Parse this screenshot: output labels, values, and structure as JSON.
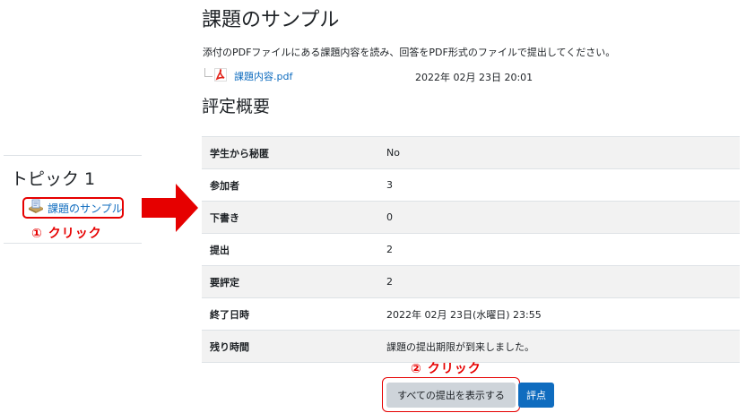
{
  "sidebar": {
    "topic_title": "トピック 1",
    "activity_link": "課題のサンプル",
    "step1_note": "① クリック"
  },
  "main": {
    "title": "課題のサンプル",
    "intro": "添付のPDFファイルにある課題内容を読み、回答をPDF形式のファイルで提出してください。",
    "attachment": {
      "name": "課題内容.pdf",
      "date": "2022年 02月 23日 20:01",
      "icon": "pdf-icon"
    },
    "summary_heading": "評定概要",
    "summary_rows": [
      {
        "key": "学生から秘匿",
        "value": "No"
      },
      {
        "key": "参加者",
        "value": "3"
      },
      {
        "key": "下書き",
        "value": "0"
      },
      {
        "key": "提出",
        "value": "2"
      },
      {
        "key": "要評定",
        "value": "2"
      },
      {
        "key": "終了日時",
        "value": "2022年 02月 23日(水曜日) 23:55"
      },
      {
        "key": "残り時間",
        "value": "課題の提出期限が到来しました。"
      }
    ],
    "step2_note": "② クリック",
    "view_all_button": "すべての提出を表示する",
    "grade_button": "評点"
  },
  "colors": {
    "accent_red": "#e60000",
    "link_blue": "#0f6cbf",
    "primary_button": "#0f6cbf",
    "secondary_button": "#ced4da",
    "row_stripe": "#f2f2f2"
  }
}
